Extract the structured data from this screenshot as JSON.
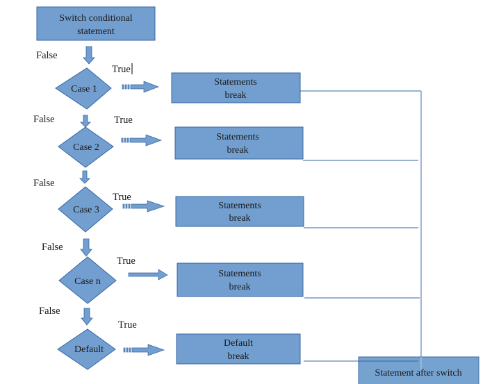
{
  "diagram": {
    "type": "flowchart",
    "colors": {
      "fill": "#729fcf",
      "stroke": "#3465a4",
      "connector": "#3465a4",
      "merge_line": "#9db5d6",
      "text": "#1a1a1a"
    },
    "start": {
      "line1": "Switch conditional",
      "line2": "statement"
    },
    "branches": [
      {
        "case": "Case 1",
        "true_label": "True",
        "false_label": "False",
        "action_line1": "Statements",
        "action_line2": "break"
      },
      {
        "case": "Case 2",
        "true_label": "True",
        "false_label": "False",
        "action_line1": "Statements",
        "action_line2": "break"
      },
      {
        "case": "Case 3",
        "true_label": "True",
        "false_label": "False",
        "action_line1": "Statements",
        "action_line2": "break"
      },
      {
        "case": "Case n",
        "true_label": "True",
        "false_label": "False",
        "action_line1": "Statements",
        "action_line2": "break"
      },
      {
        "case": "Default",
        "true_label": "True",
        "false_label": "False",
        "action_line1": "Default",
        "action_line2": "break"
      }
    ],
    "end": {
      "label": "Statement after switch"
    }
  }
}
